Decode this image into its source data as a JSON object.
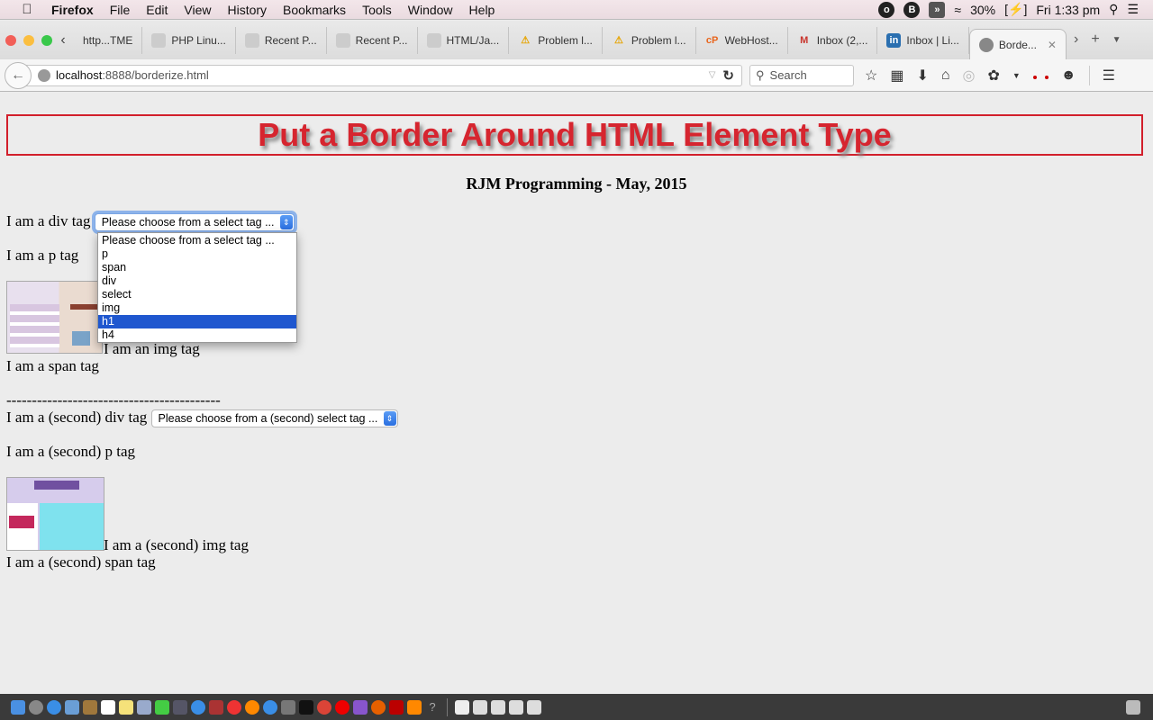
{
  "menubar": {
    "app_name": "Firefox",
    "items": [
      "File",
      "Edit",
      "View",
      "History",
      "Bookmarks",
      "Tools",
      "Window",
      "Help"
    ],
    "status_icons": [
      "circle-o-icon",
      "b-icon",
      "sound-icon",
      "wifi-icon"
    ],
    "battery": "30%",
    "clock": "Fri 1:33 pm"
  },
  "tabs": [
    {
      "label": "http...TME",
      "icon": "page-icon"
    },
    {
      "label": "PHP Linu...",
      "icon": "page-icon"
    },
    {
      "label": "Recent P...",
      "icon": "page-icon"
    },
    {
      "label": "Recent P...",
      "icon": "page-icon"
    },
    {
      "label": "HTML/Ja...",
      "icon": "page-icon"
    },
    {
      "label": "Problem l...",
      "icon": "warning-icon"
    },
    {
      "label": "Problem l...",
      "icon": "warning-icon"
    },
    {
      "label": "WebHost...",
      "icon": "cpanel-icon"
    },
    {
      "label": "Inbox (2,...",
      "icon": "gmail-icon"
    },
    {
      "label": "Inbox | Li...",
      "icon": "linkedin-icon"
    },
    {
      "label": "Borde...",
      "icon": "globe-icon",
      "active": true
    }
  ],
  "navbar": {
    "url_host": "localhost",
    "url_path": ":8888/borderize.html",
    "search_placeholder": "Search"
  },
  "page": {
    "title": "Put a Border Around HTML Element Type",
    "subtitle": "RJM Programming - May, 2015",
    "div_label": "I am a div tag",
    "select_value": "Please choose from a select tag ...",
    "select_options": [
      "Please choose from a select tag ...",
      "p",
      "span",
      "div",
      "select",
      "img",
      "h1",
      "h4"
    ],
    "highlighted_option": "h1",
    "p_label": "I am a p tag",
    "img_label": "I am an img tag",
    "span_label": "I am a span tag",
    "separator": "------------------------------------------",
    "div2_label": "I am a (second) div tag",
    "select2_value": "Please choose from a (second) select tag ...",
    "p2_label": "I am a (second) p tag",
    "img2_label": "I am a (second) img tag",
    "span2_label": "I am a (second) span tag"
  },
  "colors": {
    "title_red": "#d6252f",
    "highlight_blue": "#1f57cf"
  }
}
